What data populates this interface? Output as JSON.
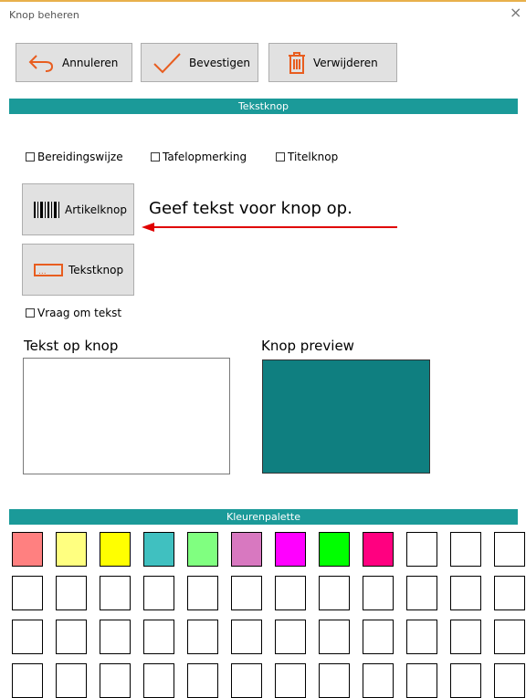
{
  "window": {
    "title": "Knop beheren",
    "close_glyph": "×"
  },
  "toolbar": {
    "cancel_label": "Annuleren",
    "confirm_label": "Bevestigen",
    "delete_label": "Verwijderen"
  },
  "sections": {
    "text_button": "Tekstknop",
    "palette": "Kleurenpalette"
  },
  "options": {
    "preparation": "Bereidingswijze",
    "table_note": "Tafelopmerking",
    "title_button": "Titelknop",
    "ask_text": "Vraag om tekst"
  },
  "button_types": {
    "article": "Artikelknop",
    "text": "Tekstknop"
  },
  "annotation": "Geef tekst voor knop op.",
  "editor": {
    "text_label": "Tekst op knop",
    "text_value": "",
    "preview_label": "Knop preview"
  },
  "colors": {
    "accent": "#1b9a99",
    "preview": "#0f7f80",
    "icon_orange": "#e85d1f",
    "arrow_red": "#e00000"
  },
  "palette": [
    "#ff8080",
    "#ffff80",
    "#ffff00",
    "#40c0c0",
    "#80ff80",
    "#d878c0",
    "#ff00ff",
    "#00ff00",
    "#ff0080",
    "#ffffff",
    "#ffffff",
    "#ffffff",
    "#ffffff",
    "#ffffff",
    "#ffffff",
    "#ffffff",
    "#ffffff",
    "#ffffff",
    "#ffffff",
    "#ffffff",
    "#ffffff",
    "#ffffff",
    "#ffffff",
    "#ffffff",
    "#ffffff",
    "#ffffff",
    "#ffffff",
    "#ffffff",
    "#ffffff",
    "#ffffff",
    "#ffffff",
    "#ffffff",
    "#ffffff",
    "#ffffff",
    "#ffffff",
    "#ffffff",
    "#ffffff",
    "#ffffff",
    "#ffffff",
    "#ffffff",
    "#ffffff",
    "#ffffff",
    "#ffffff",
    "#ffffff",
    "#ffffff",
    "#ffffff",
    "#ffffff",
    "#ffffff"
  ]
}
